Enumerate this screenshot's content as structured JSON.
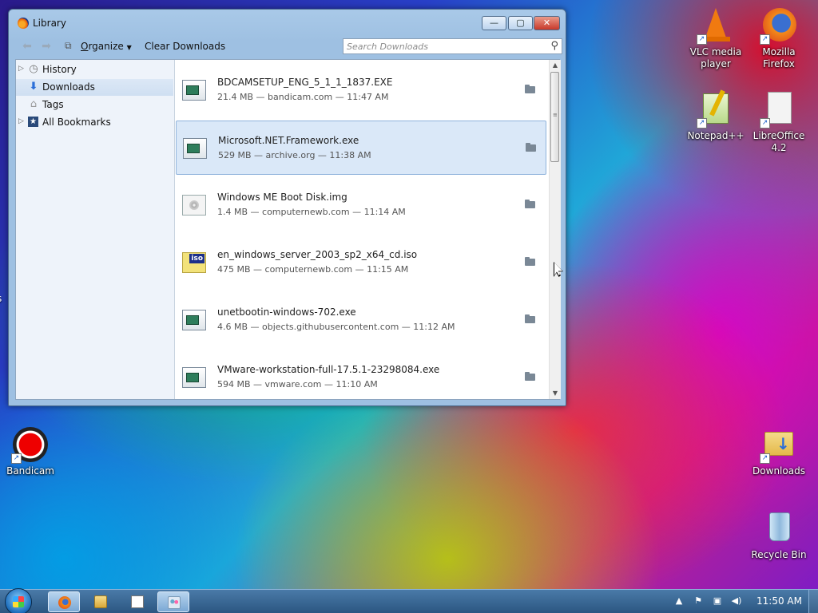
{
  "window": {
    "title": "Library",
    "buttons": {
      "minimize": "—",
      "maximize": "▢",
      "close": "✕"
    }
  },
  "toolbar": {
    "organize_label": "Organize",
    "organize_access_key": "O",
    "organize_rest": "rganize",
    "clear_label": "Clear Downloads",
    "search_placeholder": "Search Downloads"
  },
  "sidebar": {
    "items": [
      {
        "label": "History",
        "icon": "clock-icon",
        "expandable": true,
        "selected": false
      },
      {
        "label": "Downloads",
        "icon": "download-arrow-icon",
        "expandable": false,
        "selected": true
      },
      {
        "label": "Tags",
        "icon": "tag-icon",
        "expandable": false,
        "selected": false
      },
      {
        "label": "All Bookmarks",
        "icon": "bookmark-star-icon",
        "expandable": true,
        "selected": false
      }
    ]
  },
  "downloads": [
    {
      "name": "BDCAMSETUP_ENG_5_1_1_1837.EXE",
      "meta": "21.4 MB — bandicam.com — 11:47 AM",
      "icon": "exe-icon",
      "selected": false
    },
    {
      "name": "Microsoft.NET.Framework.exe",
      "meta": "529 MB — archive.org — 11:38 AM",
      "icon": "exe-icon",
      "selected": true
    },
    {
      "name": "Windows ME Boot Disk.img",
      "meta": "1.4 MB — computernewb.com — 11:14 AM",
      "icon": "disk-image-icon",
      "selected": false
    },
    {
      "name": "en_windows_server_2003_sp2_x64_cd.iso",
      "meta": "475 MB — computernewb.com — 11:15 AM",
      "icon": "iso-icon",
      "iso_label": "iso",
      "selected": false
    },
    {
      "name": "unetbootin-windows-702.exe",
      "meta": "4.6 MB — objects.githubusercontent.com — 11:12 AM",
      "icon": "exe-icon",
      "selected": false
    },
    {
      "name": "VMware-workstation-full-17.5.1-23298084.exe",
      "meta": "594 MB — vmware.com — 11:10 AM",
      "icon": "exe-icon",
      "selected": false
    }
  ],
  "desktop": {
    "icons": [
      {
        "label": "VLC media player",
        "icon": "vlc-icon"
      },
      {
        "label": "Mozilla Firefox",
        "icon": "firefox-icon"
      },
      {
        "label": "Notepad++",
        "icon": "notepadpp-icon"
      },
      {
        "label": "LibreOffice 4.2",
        "icon": "libreoffice-icon"
      },
      {
        "label": "Bandicam",
        "icon": "bandicam-icon"
      },
      {
        "label": "Downloads",
        "icon": "downloads-folder-icon"
      },
      {
        "label": "Recycle Bin",
        "icon": "recycle-bin-icon"
      }
    ],
    "edge_text": "s"
  },
  "taskbar": {
    "clock": "11:50 AM",
    "pinned": [
      "firefox-icon",
      "explorer-icon",
      "notepad-icon",
      "users-icon"
    ],
    "tray": [
      "show-hidden-icon",
      "flag-icon",
      "network-icon",
      "volume-icon"
    ]
  },
  "colors": {
    "selection_bg": "#dae8f8",
    "selection_border": "#8fb3dc",
    "titlebar": "#a9c9e8",
    "taskbar": "#2a5580"
  }
}
